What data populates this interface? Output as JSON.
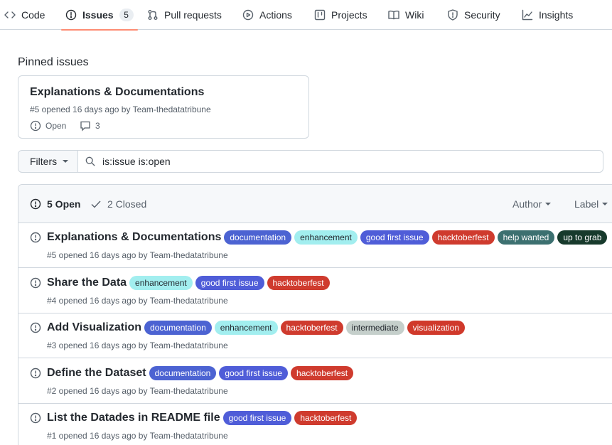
{
  "nav": {
    "code": "Code",
    "issues": "Issues",
    "issues_count": "5",
    "pull_requests": "Pull requests",
    "actions": "Actions",
    "projects": "Projects",
    "wiki": "Wiki",
    "security": "Security",
    "insights": "Insights"
  },
  "pinned": {
    "heading": "Pinned issues",
    "title": "Explanations & Documentations",
    "meta": "#5 opened 16 days ago by Team-thedatatribune",
    "state": "Open",
    "comments": "3"
  },
  "filters": {
    "button_label": "Filters",
    "search_value": "is:issue is:open"
  },
  "list_header": {
    "open_label": "5 Open",
    "closed_label": "2 Closed",
    "author_label": "Author",
    "label_label": "Label"
  },
  "label_colors": {
    "documentation": {
      "bg": "#4c63d2",
      "fg": "#ffffff"
    },
    "enhancement": {
      "bg": "#a2eeef",
      "fg": "#24292f"
    },
    "good first issue": {
      "bg": "#4f5dd8",
      "fg": "#ffffff"
    },
    "hacktoberfest": {
      "bg": "#cf3b2e",
      "fg": "#ffffff"
    },
    "help wanted": {
      "bg": "#3c7070",
      "fg": "#ffffff"
    },
    "up to grab": {
      "bg": "#173a2c",
      "fg": "#ffffff"
    },
    "intermediate": {
      "bg": "#c5cfcb",
      "fg": "#24292f"
    },
    "visualization": {
      "bg": "#d0392b",
      "fg": "#ffffff"
    }
  },
  "issues": [
    {
      "title": "Explanations & Documentations",
      "meta": "#5 opened 16 days ago by Team-thedatatribune",
      "labels": [
        "documentation",
        "enhancement",
        "good first issue",
        "hacktoberfest",
        "help wanted",
        "up to grab"
      ]
    },
    {
      "title": "Share the Data",
      "meta": "#4 opened 16 days ago by Team-thedatatribune",
      "labels": [
        "enhancement",
        "good first issue",
        "hacktoberfest"
      ]
    },
    {
      "title": "Add Visualization",
      "meta": "#3 opened 16 days ago by Team-thedatatribune",
      "labels": [
        "documentation",
        "enhancement",
        "hacktoberfest",
        "intermediate",
        "visualization"
      ]
    },
    {
      "title": "Define the Dataset",
      "meta": "#2 opened 16 days ago by Team-thedatatribune",
      "labels": [
        "documentation",
        "good first issue",
        "hacktoberfest"
      ]
    },
    {
      "title": "List the Datades in README file",
      "meta": "#1 opened 16 days ago by Team-thedatatribune",
      "labels": [
        "good first issue",
        "hacktoberfest"
      ]
    }
  ]
}
